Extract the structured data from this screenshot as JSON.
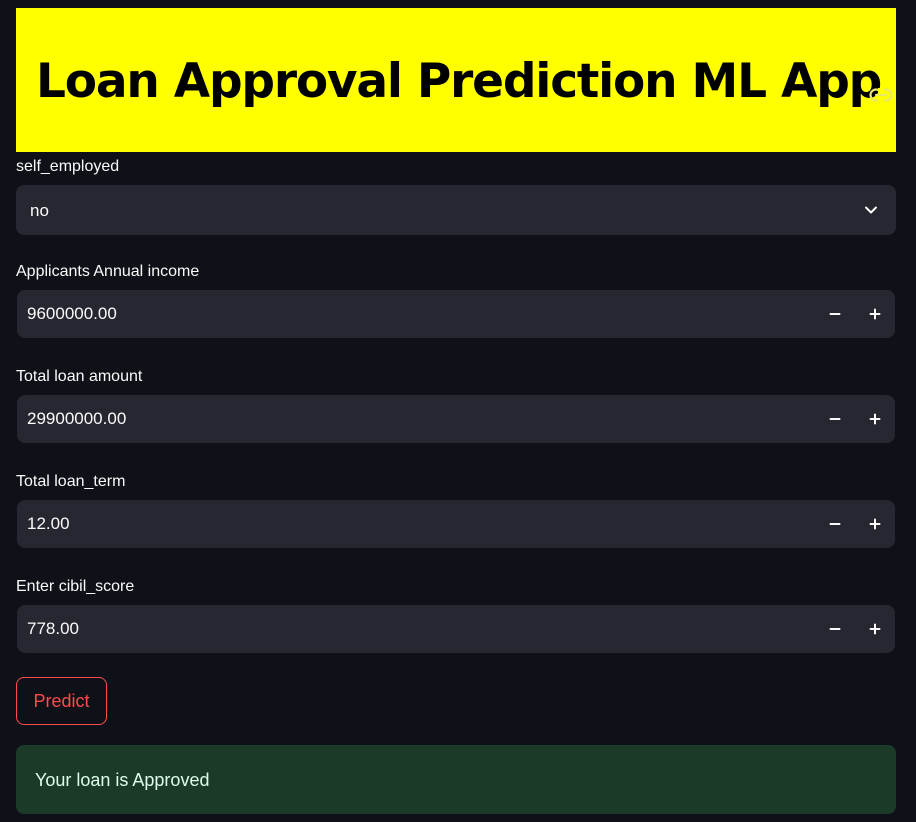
{
  "header": {
    "title": "Loan Approval Prediction ML App",
    "background_color": "#ffff00",
    "anchor_icon": "link-icon"
  },
  "form": {
    "self_employed": {
      "label": "self_employed",
      "value": "no",
      "icon": "chevron-down-icon"
    },
    "income": {
      "label": "Applicants Annual income",
      "value": "9600000.00"
    },
    "loan_amount": {
      "label": "Total loan amount",
      "value": "29900000.00"
    },
    "loan_term": {
      "label": "Total loan_term",
      "value": "12.00"
    },
    "cibil_score": {
      "label": "Enter cibil_score",
      "value": "778.00"
    },
    "stepper_icons": {
      "minus": "minus-icon",
      "plus": "plus-icon"
    }
  },
  "predict_button": {
    "label": "Predict",
    "color": "#ff4b4b"
  },
  "result": {
    "message": "Your loan is Approved",
    "background_color": "#1b3a28"
  },
  "theme": {
    "background": "#0e1117",
    "input_background": "#262730",
    "text": "#fafafa"
  }
}
